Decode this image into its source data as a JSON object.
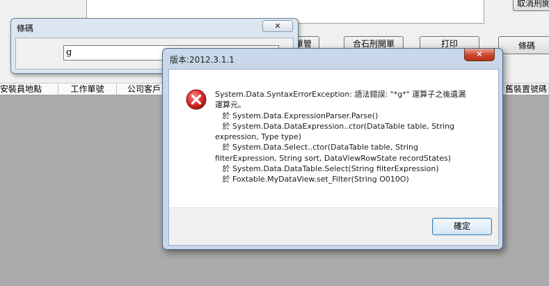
{
  "app": {
    "top_right_button": "取消刑開",
    "toolbar": [
      "單管",
      "合石刑開單",
      "打印",
      "條碼"
    ]
  },
  "grid": {
    "columns": [
      "安裝員地點",
      "工作單號",
      "公司客戶",
      "舊裝置號碼"
    ]
  },
  "barcode_dialog": {
    "title": "條碼",
    "input_value": "g",
    "close_glyph": "✕"
  },
  "error_dialog": {
    "title": "版本:2012.3.1.1",
    "close_glyph": "✕",
    "icon": "error-icon",
    "message": "System.Data.SyntaxErrorException: 語法錯誤: \"*g*\" 運算子之後遺漏\n運算元。\n   於 System.Data.ExpressionParser.Parse()\n   於 System.Data.DataExpression..ctor(DataTable table, String\nexpression, Type type)\n   於 System.Data.Select..ctor(DataTable table, String\nfilterExpression, String sort, DataViewRowState recordStates)\n   於 System.Data.DataTable.Select(String filterExpression)\n   於 Foxtable.MyDataView.set_Filter(String O010O)",
    "ok_label": "確定"
  },
  "colors": {
    "error_red": "#d62a2a",
    "close_red": "#c7452b",
    "workspace_gray": "#ababab"
  }
}
